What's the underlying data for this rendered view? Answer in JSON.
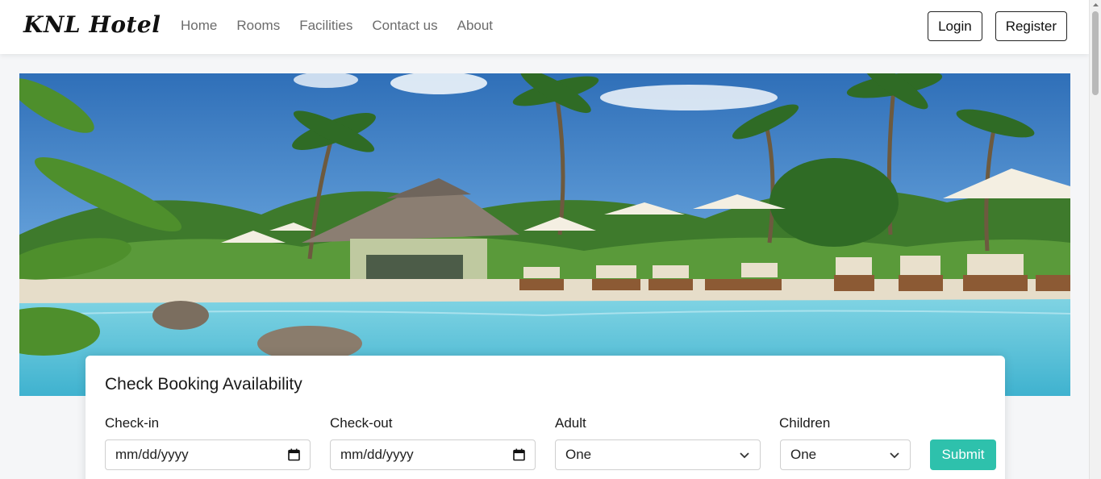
{
  "navbar": {
    "brand": "KNL Hotel",
    "links": [
      "Home",
      "Rooms",
      "Facilities",
      "Contact us",
      "About"
    ],
    "login_label": "Login",
    "register_label": "Register"
  },
  "hero": {
    "image": "resort-pool-with-palm-trees"
  },
  "booking": {
    "title": "Check Booking Availability",
    "checkin": {
      "label": "Check-in",
      "value": "mm/dd/yyyy",
      "icon": "calendar-icon"
    },
    "checkout": {
      "label": "Check-out",
      "value": "mm/dd/yyyy",
      "icon": "calendar-icon"
    },
    "adult": {
      "label": "Adult",
      "value": "One",
      "icon": "chevron-down-icon"
    },
    "children": {
      "label": "Children",
      "value": "One",
      "icon": "chevron-down-icon"
    },
    "submit_label": "Submit"
  },
  "colors": {
    "accent": "#2ec1ac",
    "text": "#1a1a1a",
    "nav_text": "#6c6c6c"
  }
}
